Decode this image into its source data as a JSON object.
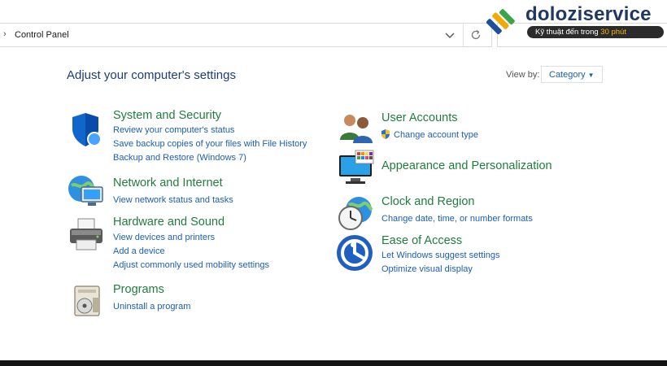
{
  "address_bar": {
    "chevron": "›",
    "path": "Control Panel"
  },
  "watermark": {
    "brand": "doloziservice",
    "tagline_prefix": "Kỹ thuật đến trong ",
    "tagline_highlight": "30 phút"
  },
  "main": {
    "heading": "Adjust your computer's settings",
    "view_by_label": "View by:",
    "view_by_value": "Category"
  },
  "categories_left": [
    {
      "title": "System and Security",
      "icon": "shield-icon",
      "links": [
        "Review your computer's status",
        "Save backup copies of your files with File History",
        "Backup and Restore (Windows 7)"
      ]
    },
    {
      "title": "Network and Internet",
      "icon": "network-globe-icon",
      "links": [
        "View network status and tasks"
      ]
    },
    {
      "title": "Hardware and Sound",
      "icon": "printer-icon",
      "links": [
        "View devices and printers",
        "Add a device",
        "Adjust commonly used mobility settings"
      ]
    },
    {
      "title": "Programs",
      "icon": "programs-icon",
      "links": [
        "Uninstall a program"
      ]
    }
  ],
  "categories_right": [
    {
      "title": "User Accounts",
      "icon": "users-icon",
      "links": [
        "Change account type"
      ]
    },
    {
      "title": "Appearance and Personalization",
      "icon": "monitor-palette-icon",
      "links": []
    },
    {
      "title": "Clock and Region",
      "icon": "clock-globe-icon",
      "links": [
        "Change date, time, or number formats"
      ]
    },
    {
      "title": "Ease of Access",
      "icon": "ease-of-access-icon",
      "links": [
        "Let Windows suggest settings",
        "Optimize visual display"
      ]
    }
  ],
  "colors": {
    "category_title": "#217d3e",
    "link": "#1a5fb4",
    "heading": "#1e3c78"
  }
}
